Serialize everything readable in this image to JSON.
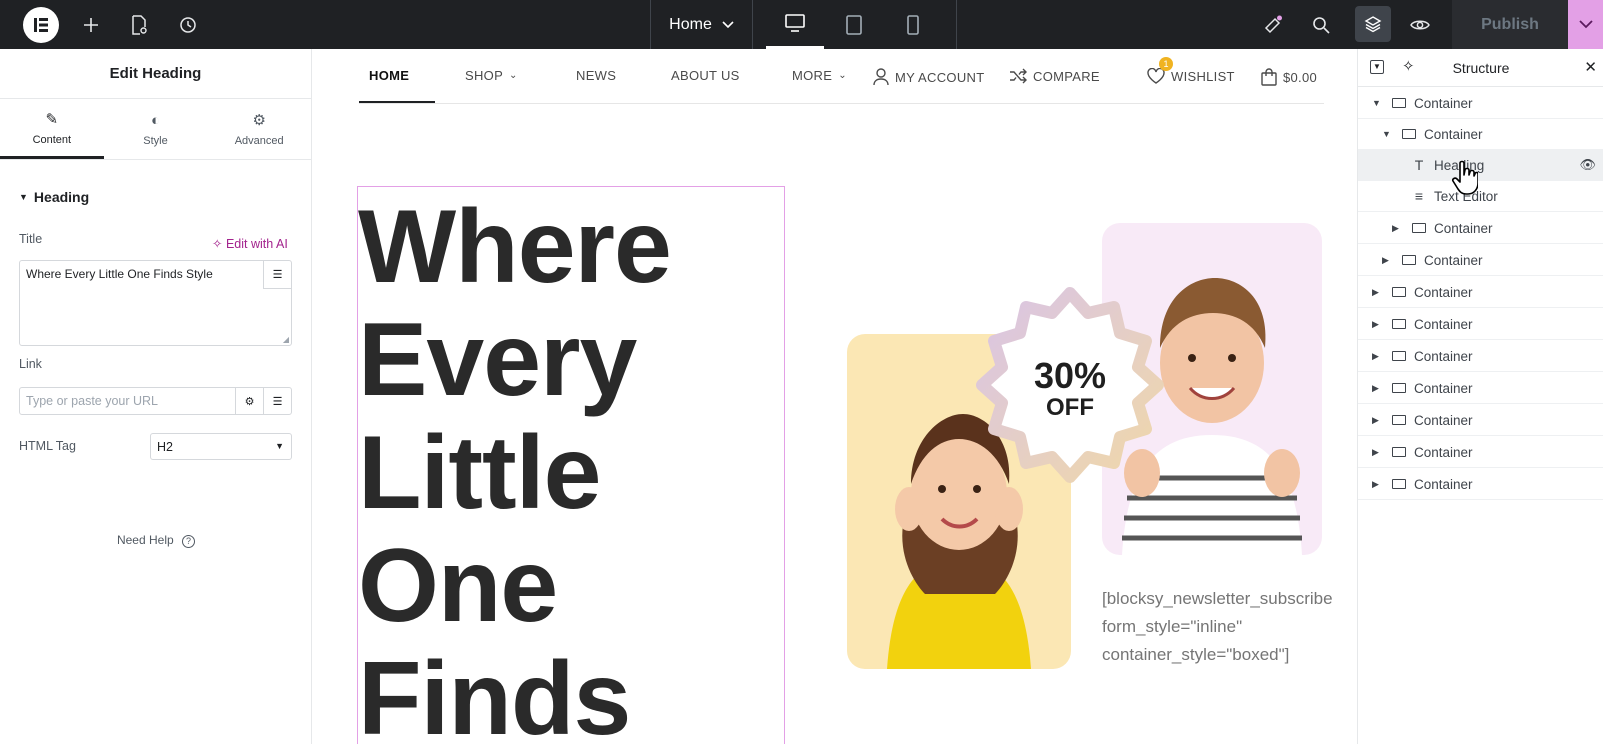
{
  "topbar": {
    "page_name": "Home",
    "publish_label": "Publish",
    "icons": [
      "elementor-logo-icon",
      "add-icon",
      "page-settings-icon",
      "history-icon",
      "chevron-down-icon",
      "desktop-icon",
      "tablet-icon",
      "mobile-icon",
      "notifications-icon",
      "search-icon",
      "layers-icon",
      "preview-eye-icon",
      "chevron-down-icon"
    ]
  },
  "panel": {
    "title": "Edit Heading",
    "tabs": [
      {
        "label": "Content",
        "icon": "pencil-icon"
      },
      {
        "label": "Style",
        "icon": "contrast-icon"
      },
      {
        "label": "Advanced",
        "icon": "gear-icon"
      }
    ],
    "section": "Heading",
    "title_label": "Title",
    "edit_ai_label": "Edit with AI",
    "title_value": "Where Every Little One Finds Style",
    "link_label": "Link",
    "link_placeholder": "Type or paste your URL",
    "html_tag_label": "HTML Tag",
    "html_tag_value": "H2",
    "need_help": "Need Help"
  },
  "site": {
    "nav": [
      {
        "label": "HOME"
      },
      {
        "label": "SHOP"
      },
      {
        "label": "NEWS"
      },
      {
        "label": "ABOUT US"
      },
      {
        "label": "MORE"
      },
      {
        "label": "MY ACCOUNT"
      },
      {
        "label": "COMPARE"
      },
      {
        "label": "WISHLIST"
      },
      {
        "label": "$0.00"
      }
    ],
    "wishlist_count": "1",
    "heading_lines": [
      "Where",
      "Every",
      "Little",
      "One",
      "Finds"
    ],
    "offer_percent": "30%",
    "offer_off": "OFF",
    "shortcode": "[blocksy_newsletter_subscribe form_style=\"inline\" container_style=\"boxed\"]",
    "colors": {
      "left_card": "#fbe7b4",
      "right_card": "#f8eaf7",
      "selection_border": "#e3a0e6"
    }
  },
  "structure": {
    "title": "Structure",
    "rows": [
      {
        "label": "Container",
        "type": "container",
        "expanded": true
      },
      {
        "label": "Container",
        "type": "container",
        "expanded": true
      },
      {
        "label": "Heading",
        "type": "heading",
        "selected": true
      },
      {
        "label": "Text Editor",
        "type": "text"
      },
      {
        "label": "Container",
        "type": "container"
      },
      {
        "label": "Container",
        "type": "container"
      },
      {
        "label": "Container",
        "type": "container"
      },
      {
        "label": "Container",
        "type": "container"
      },
      {
        "label": "Container",
        "type": "container"
      },
      {
        "label": "Container",
        "type": "container"
      },
      {
        "label": "Container",
        "type": "container"
      },
      {
        "label": "Container",
        "type": "container"
      },
      {
        "label": "Container",
        "type": "container"
      }
    ]
  }
}
